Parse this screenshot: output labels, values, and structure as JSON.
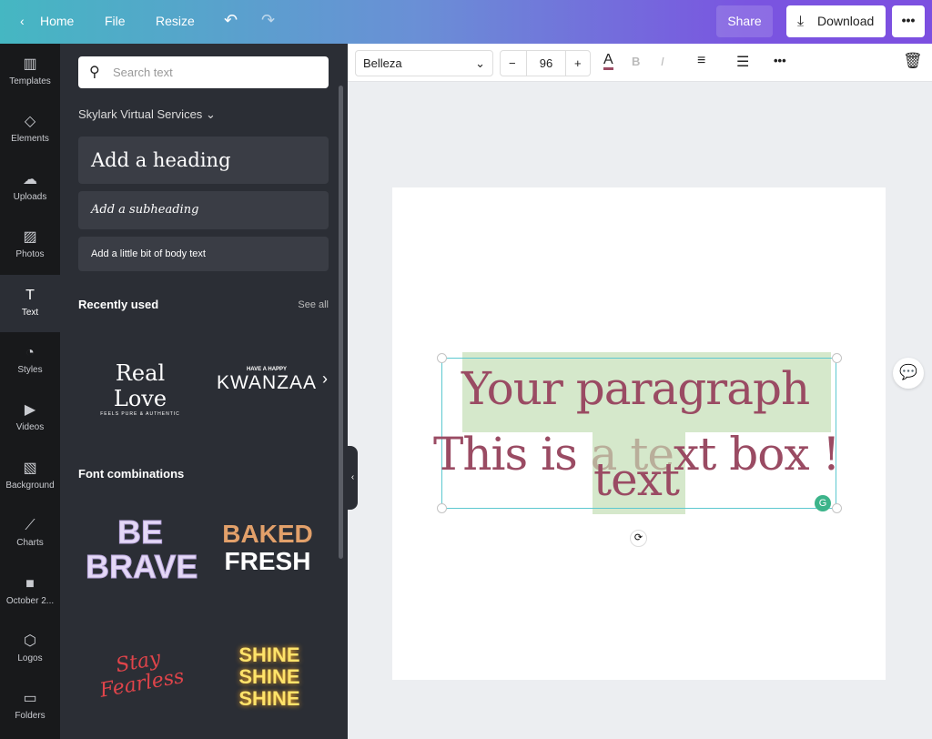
{
  "topbar": {
    "home": "Home",
    "file": "File",
    "resize": "Resize",
    "share": "Share",
    "download": "Download",
    "more": "•••"
  },
  "rail": [
    {
      "label": "Templates",
      "icon": "▥"
    },
    {
      "label": "Elements",
      "icon": "◇"
    },
    {
      "label": "Uploads",
      "icon": "☁"
    },
    {
      "label": "Photos",
      "icon": "▨"
    },
    {
      "label": "Text",
      "icon": "T"
    },
    {
      "label": "Styles",
      "icon": "◔"
    },
    {
      "label": "Videos",
      "icon": "▶"
    },
    {
      "label": "Background",
      "icon": "▧"
    },
    {
      "label": "Charts",
      "icon": "⟋"
    },
    {
      "label": "October 2...",
      "icon": "■"
    },
    {
      "label": "Logos",
      "icon": "⬡"
    },
    {
      "label": "Folders",
      "icon": "▭"
    }
  ],
  "panel": {
    "search_placeholder": "Search text",
    "brand": "Skylark Virtual Services",
    "heading": "Add a heading",
    "subheading": "Add a subheading",
    "body": "Add a little bit of body text",
    "recent": "Recently used",
    "see_all": "See all",
    "fonts": "Font combinations",
    "templates": {
      "real_love": "Real Love",
      "real_love_sub": "FEELS PURE & AUTHENTIC",
      "kwanzaa_top": "HAVE A HAPPY",
      "kwanzaa": "KWANZAA",
      "be": "BE",
      "brave": "BRAVE",
      "baked": "BAKED",
      "fresh": "FRESH",
      "stay": "Stay",
      "fearless": "Fearless",
      "shine": "SHINE"
    }
  },
  "toolbar": {
    "font": "Belleza",
    "size": "96",
    "minus": "−",
    "plus": "+"
  },
  "canvas": {
    "line1": "Your paragraph",
    "line2a": "This is ",
    "line2b": "a te",
    "line2c": "xt box !",
    "overlay": "text",
    "text_color": "#9a4b63",
    "highlight": "#d5e8cb"
  }
}
